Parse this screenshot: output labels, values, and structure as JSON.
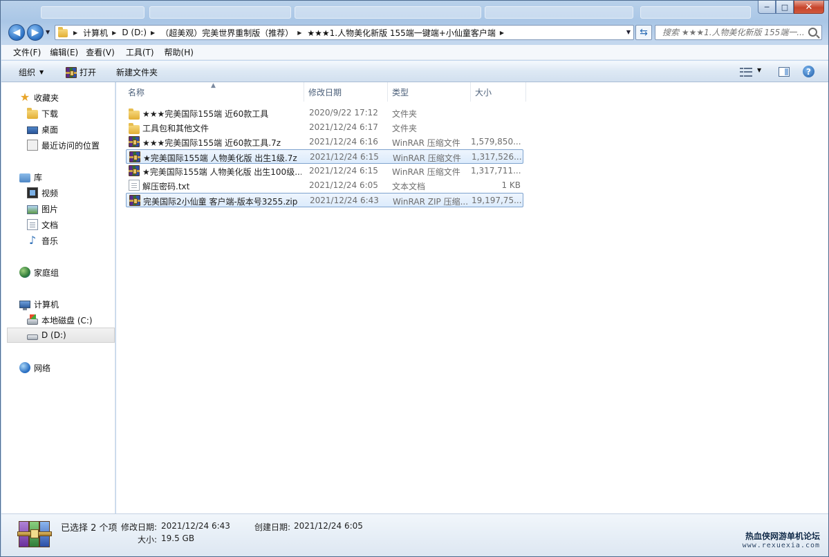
{
  "window": {
    "buttons": {
      "minimize": "─",
      "maximize": "□",
      "close": "✕"
    }
  },
  "address": {
    "crumbs": [
      "计算机",
      "D (D:)",
      "（超美观）完美世界重制版（推荐）",
      "★★★1.人物美化新版 155端一键端+小仙童客户端"
    ],
    "search_placeholder": "搜索 ★★★1.人物美化新版 155端一..."
  },
  "menubar": {
    "items": [
      "文件(F)",
      "编辑(E)",
      "查看(V)",
      "工具(T)",
      "帮助(H)"
    ]
  },
  "toolbar": {
    "organize": "组织",
    "open": "打开",
    "new_folder": "新建文件夹"
  },
  "nav": {
    "favorites": "收藏夹",
    "downloads": "下载",
    "desktop": "桌面",
    "recent": "最近访问的位置",
    "libraries": "库",
    "videos": "视频",
    "pictures": "图片",
    "documents": "文档",
    "music": "音乐",
    "homegroup": "家庭组",
    "computer": "计算机",
    "drive_c": "本地磁盘 (C:)",
    "drive_d": "D (D:)",
    "network": "网络"
  },
  "columns": {
    "name": "名称",
    "modified": "修改日期",
    "type": "类型",
    "size": "大小"
  },
  "files": [
    {
      "name": "★★★完美国际155端 近60款工具",
      "date": "2020/9/22 17:12",
      "type": "文件夹",
      "size": "",
      "icon": "folder-icon",
      "selected": false
    },
    {
      "name": "工具包和其他文件",
      "date": "2021/12/24 6:17",
      "type": "文件夹",
      "size": "",
      "icon": "folder-icon",
      "selected": false
    },
    {
      "name": "★★★完美国际155端 近60款工具.7z",
      "date": "2021/12/24 6:16",
      "type": "WinRAR 压缩文件",
      "size": "1,579,850...",
      "icon": "winrar-icon",
      "selected": false
    },
    {
      "name": "★完美国际155端 人物美化版 出生1级.7z",
      "date": "2021/12/24 6:15",
      "type": "WinRAR 压缩文件",
      "size": "1,317,526...",
      "icon": "winrar-icon",
      "selected": true
    },
    {
      "name": "★完美国际155端 人物美化版 出生100级...",
      "date": "2021/12/24 6:15",
      "type": "WinRAR 压缩文件",
      "size": "1,317,711...",
      "icon": "winrar-icon",
      "selected": false
    },
    {
      "name": "解压密码.txt",
      "date": "2021/12/24 6:05",
      "type": "文本文档",
      "size": "1 KB",
      "icon": "text-file-icon",
      "selected": false
    },
    {
      "name": "完美国际2小仙童 客户端-版本号3255.zip",
      "date": "2021/12/24 6:43",
      "type": "WinRAR ZIP 压缩...",
      "size": "19,197,75...",
      "icon": "winrar-icon",
      "selected": true
    }
  ],
  "details": {
    "selection": "已选择 2 个项",
    "modified_label": "修改日期:",
    "modified_value": "2021/12/24 6:43",
    "created_label": "创建日期:",
    "created_value": "2021/12/24 6:05",
    "size_label": "大小:",
    "size_value": "19.5 GB"
  },
  "watermark": {
    "line1": "热血侠网游单机论坛",
    "line2": "www.rexuexia.com"
  }
}
